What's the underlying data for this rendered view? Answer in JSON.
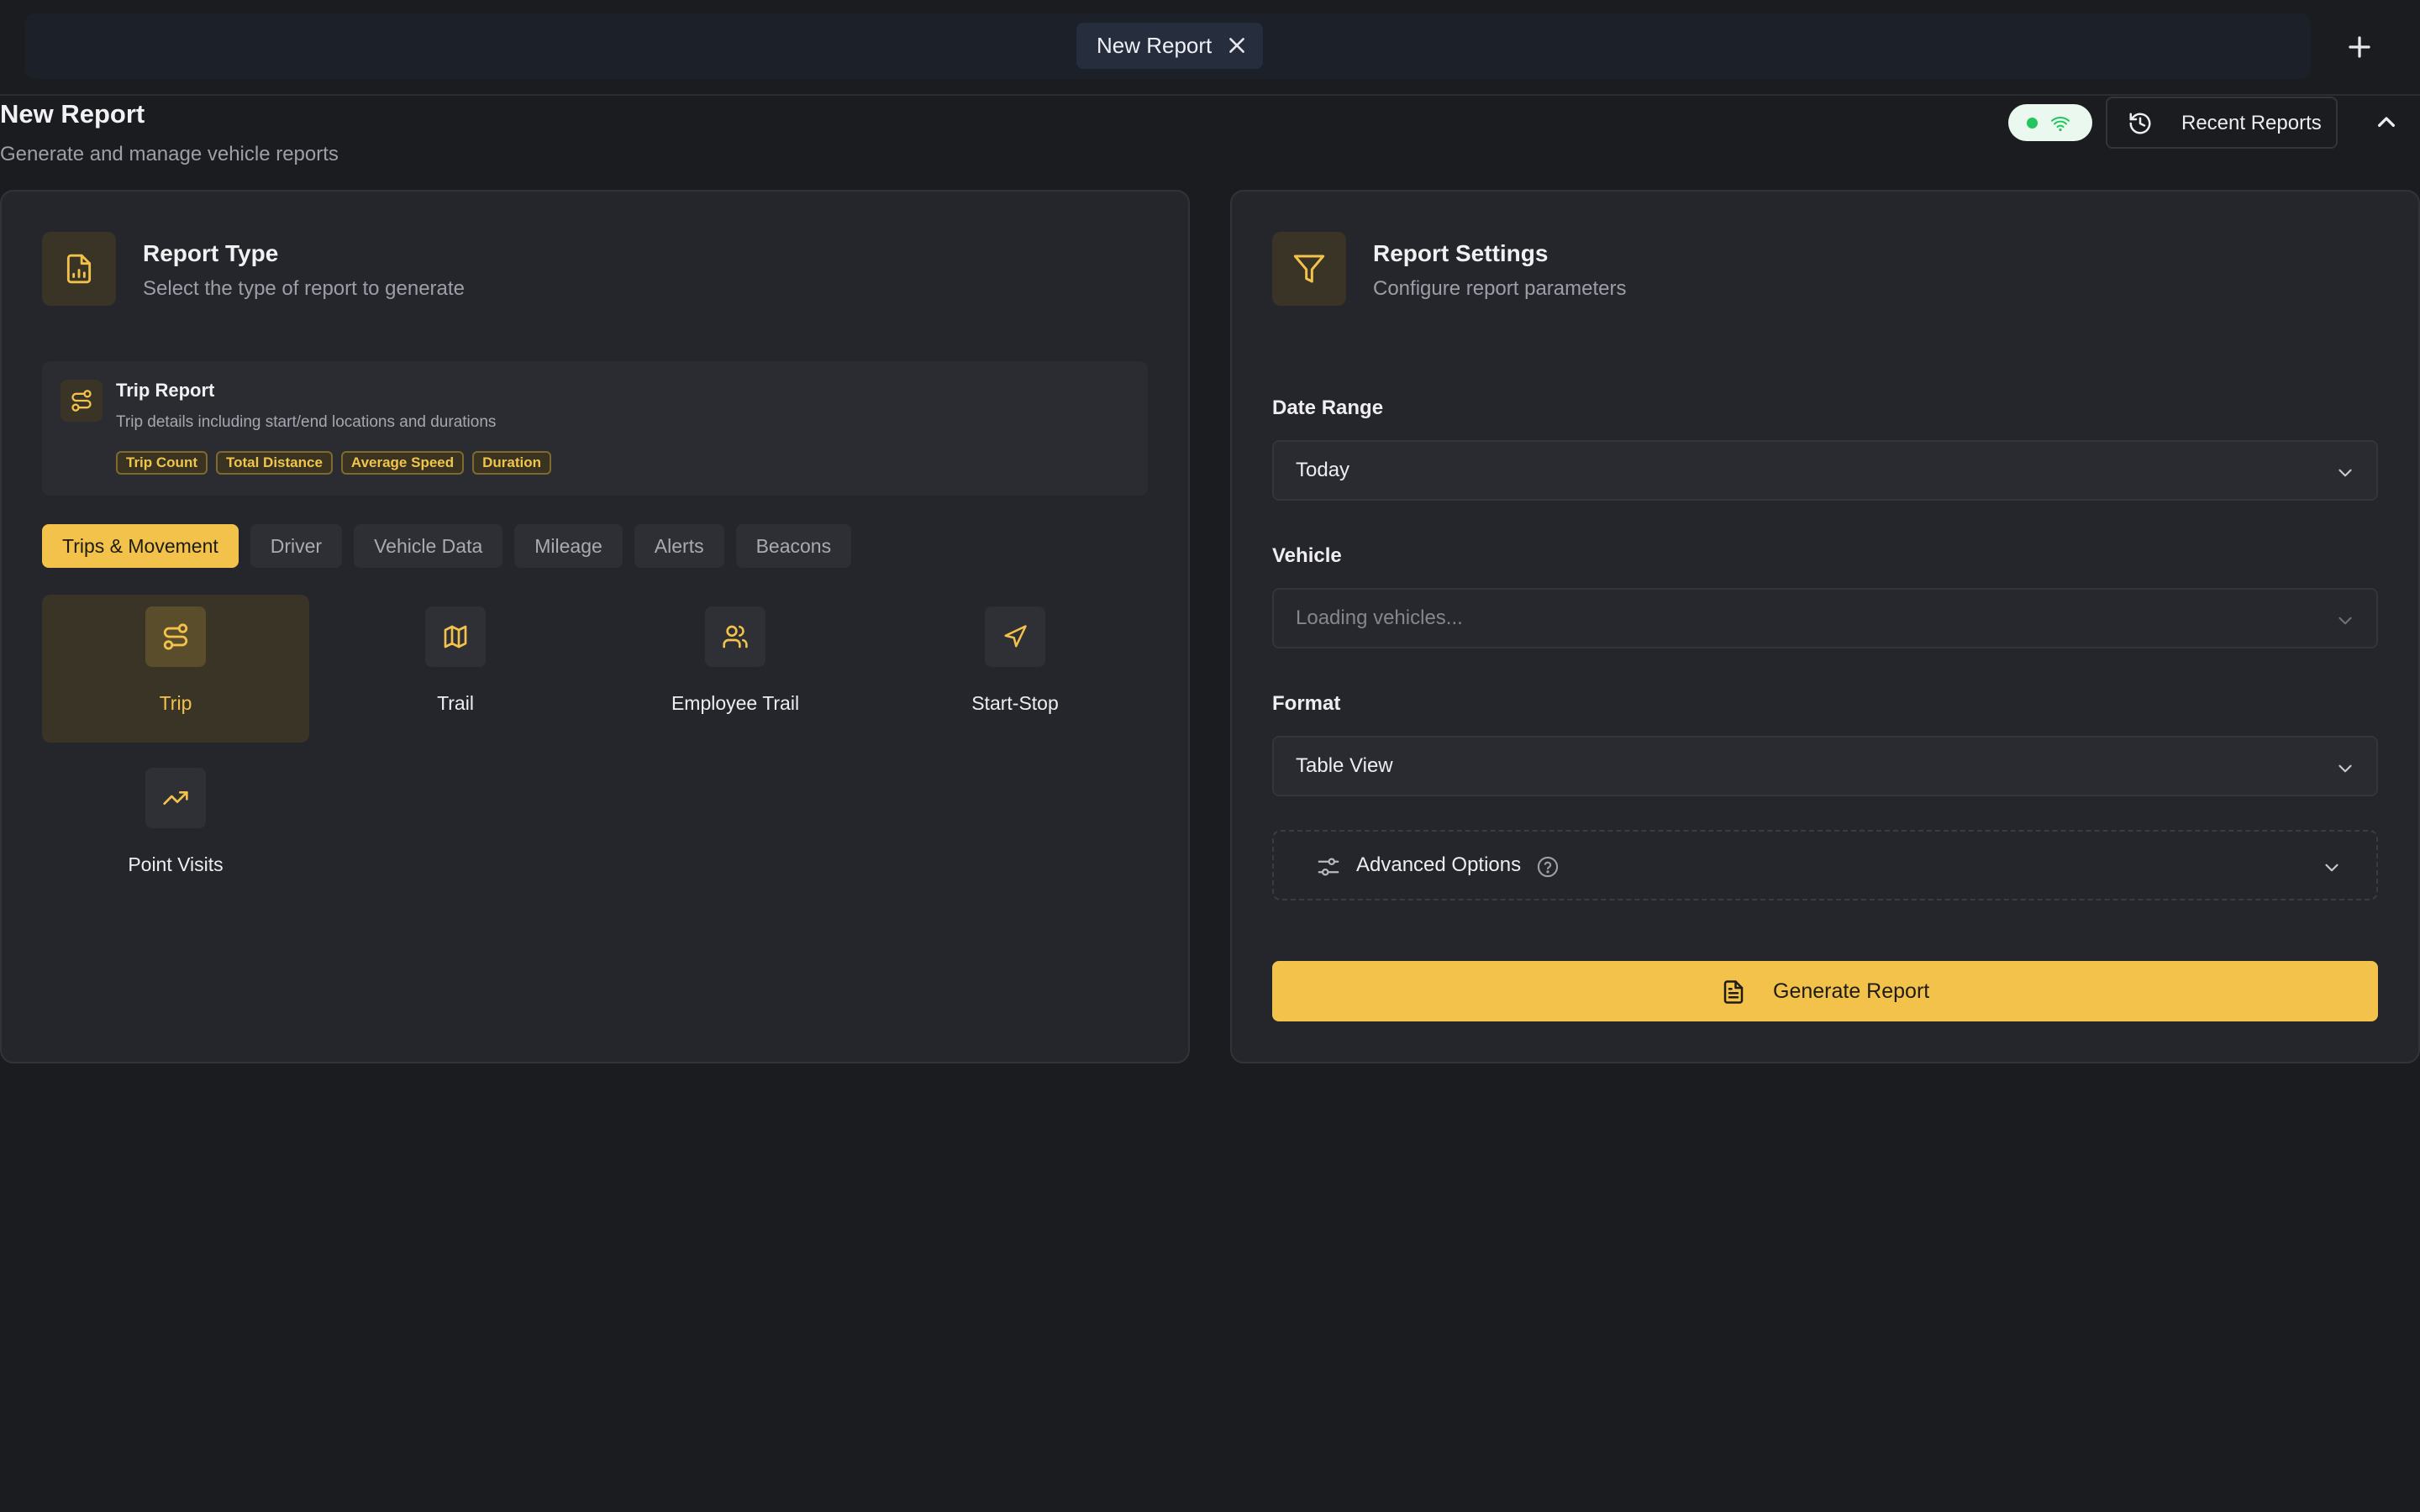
{
  "tabs": {
    "items": [
      {
        "label": "New Report"
      }
    ]
  },
  "header": {
    "title": "New Report",
    "subtitle": "Generate and manage vehicle reports",
    "recent_reports_label": "Recent Reports",
    "connection_status": "online"
  },
  "report_type_panel": {
    "title": "Report Type",
    "subtitle": "Select the type of report to generate",
    "selected_info": {
      "title": "Trip Report",
      "description": "Trip details including start/end locations and durations",
      "tags": [
        "Trip Count",
        "Total Distance",
        "Average Speed",
        "Duration"
      ]
    },
    "categories": [
      {
        "label": "Trips & Movement",
        "active": true
      },
      {
        "label": "Driver",
        "active": false
      },
      {
        "label": "Vehicle Data",
        "active": false
      },
      {
        "label": "Mileage",
        "active": false
      },
      {
        "label": "Alerts",
        "active": false
      },
      {
        "label": "Beacons",
        "active": false
      }
    ],
    "types": [
      {
        "label": "Trip",
        "icon": "route-icon",
        "active": true
      },
      {
        "label": "Trail",
        "icon": "map-icon",
        "active": false
      },
      {
        "label": "Employee Trail",
        "icon": "users-icon",
        "active": false
      },
      {
        "label": "Start-Stop",
        "icon": "navigation-icon",
        "active": false
      },
      {
        "label": "Point Visits",
        "icon": "trending-up-icon",
        "active": false
      }
    ]
  },
  "settings_panel": {
    "title": "Report Settings",
    "subtitle": "Configure report parameters",
    "date_range": {
      "label": "Date Range",
      "value": "Today"
    },
    "vehicle": {
      "label": "Vehicle",
      "value": "Loading vehicles..."
    },
    "format": {
      "label": "Format",
      "value": "Table View"
    },
    "advanced_label": "Advanced Options",
    "generate_label": "Generate Report"
  },
  "colors": {
    "accent": "#f2c24b",
    "background": "#1b1c20",
    "panel": "#25262b",
    "online": "#22c55e"
  }
}
